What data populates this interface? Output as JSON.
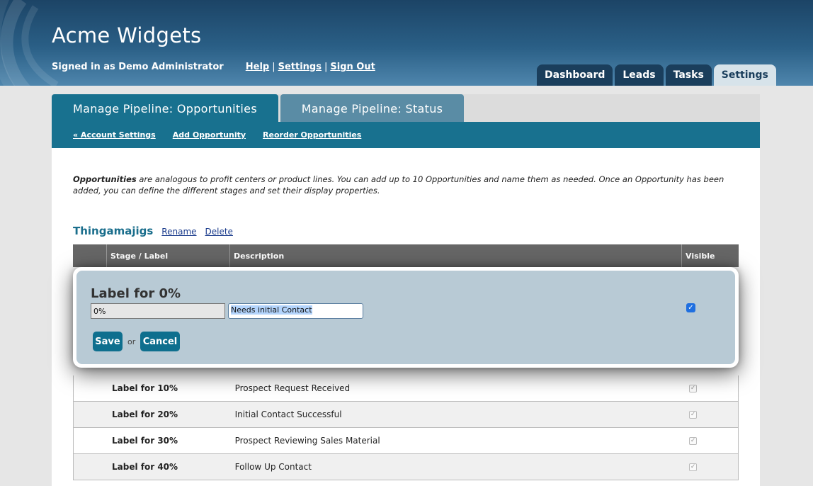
{
  "app": {
    "title": "Acme Widgets",
    "signed_in": "Signed in as Demo Administrator",
    "links": [
      "Help",
      "Settings",
      "Sign Out"
    ]
  },
  "main_tabs": [
    {
      "label": "Dashboard",
      "active": false
    },
    {
      "label": "Leads",
      "active": false
    },
    {
      "label": "Tasks",
      "active": false
    },
    {
      "label": "Settings",
      "active": true
    }
  ],
  "sub_tabs": [
    {
      "label": "Manage Pipeline: Opportunities",
      "active": true
    },
    {
      "label": "Manage Pipeline: Status",
      "active": false
    }
  ],
  "sub_nav": [
    "« Account Settings",
    "Add Opportunity",
    "Reorder Opportunities"
  ],
  "intro": {
    "bold": "Opportunities",
    "text": " are analogous to profit centers or product lines. You can add up to 10 Opportunities and name them as needed. Once an Opportunity has been added, you can define the different stages and set their display properties."
  },
  "section": {
    "title": "Thingamajigs",
    "rename": "Rename",
    "delete": "Delete"
  },
  "table": {
    "headers": [
      "",
      "Stage / Label",
      "Description",
      "Visible"
    ],
    "rows": [
      {
        "stage": "Label for 10%",
        "description": "Prospect Request Received",
        "visible": true
      },
      {
        "stage": "Label for 20%",
        "description": "Initial Contact Successful",
        "visible": true
      },
      {
        "stage": "Label for 30%",
        "description": "Prospect Reviewing Sales Material",
        "visible": true
      },
      {
        "stage": "Label for 40%",
        "description": "Follow Up Contact",
        "visible": true
      }
    ]
  },
  "edit": {
    "title": "Label for 0%",
    "label_value": "0%",
    "description_value": "Needs initial Contact",
    "visible": true,
    "save": "Save",
    "or": "or",
    "cancel": "Cancel"
  },
  "colors": {
    "header_dark": "#1c4466",
    "tab_teal": "#18718f",
    "button": "#0e6f8e",
    "section_title": "#1a6e8c"
  }
}
